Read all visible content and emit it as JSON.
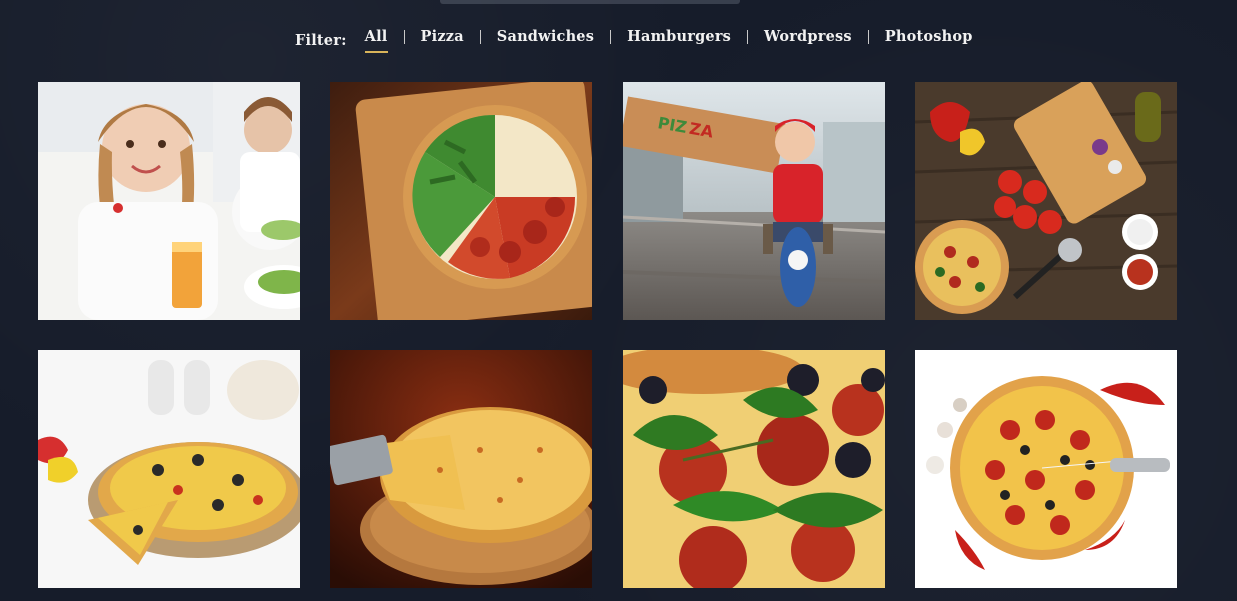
{
  "filters": {
    "label": "Filter:",
    "items": [
      {
        "label": "All",
        "active": true
      },
      {
        "label": "Pizza",
        "active": false
      },
      {
        "label": "Sandwiches",
        "active": false
      },
      {
        "label": "Hamburgers",
        "active": false
      },
      {
        "label": "Wordpress",
        "active": false
      },
      {
        "label": "Photoshop",
        "active": false
      }
    ]
  },
  "gallery": {
    "items": [
      {
        "category": "kids-eating",
        "caption": ""
      },
      {
        "category": "italian-flag-pizza",
        "caption": ""
      },
      {
        "category": "pizza-delivery",
        "caption": "PIZZA"
      },
      {
        "category": "pizza-ingredients-board",
        "caption": ""
      },
      {
        "category": "sliced-pizza-white",
        "caption": ""
      },
      {
        "category": "cheese-pizza-spatula",
        "caption": ""
      },
      {
        "category": "pepperoni-basil-closeup",
        "caption": ""
      },
      {
        "category": "pizza-chili-knife",
        "caption": ""
      }
    ]
  },
  "colors": {
    "background": "#161c2a",
    "active_underline": "#d8b45a",
    "text": "#f2f2f2",
    "separator": "#c9c9c9"
  }
}
